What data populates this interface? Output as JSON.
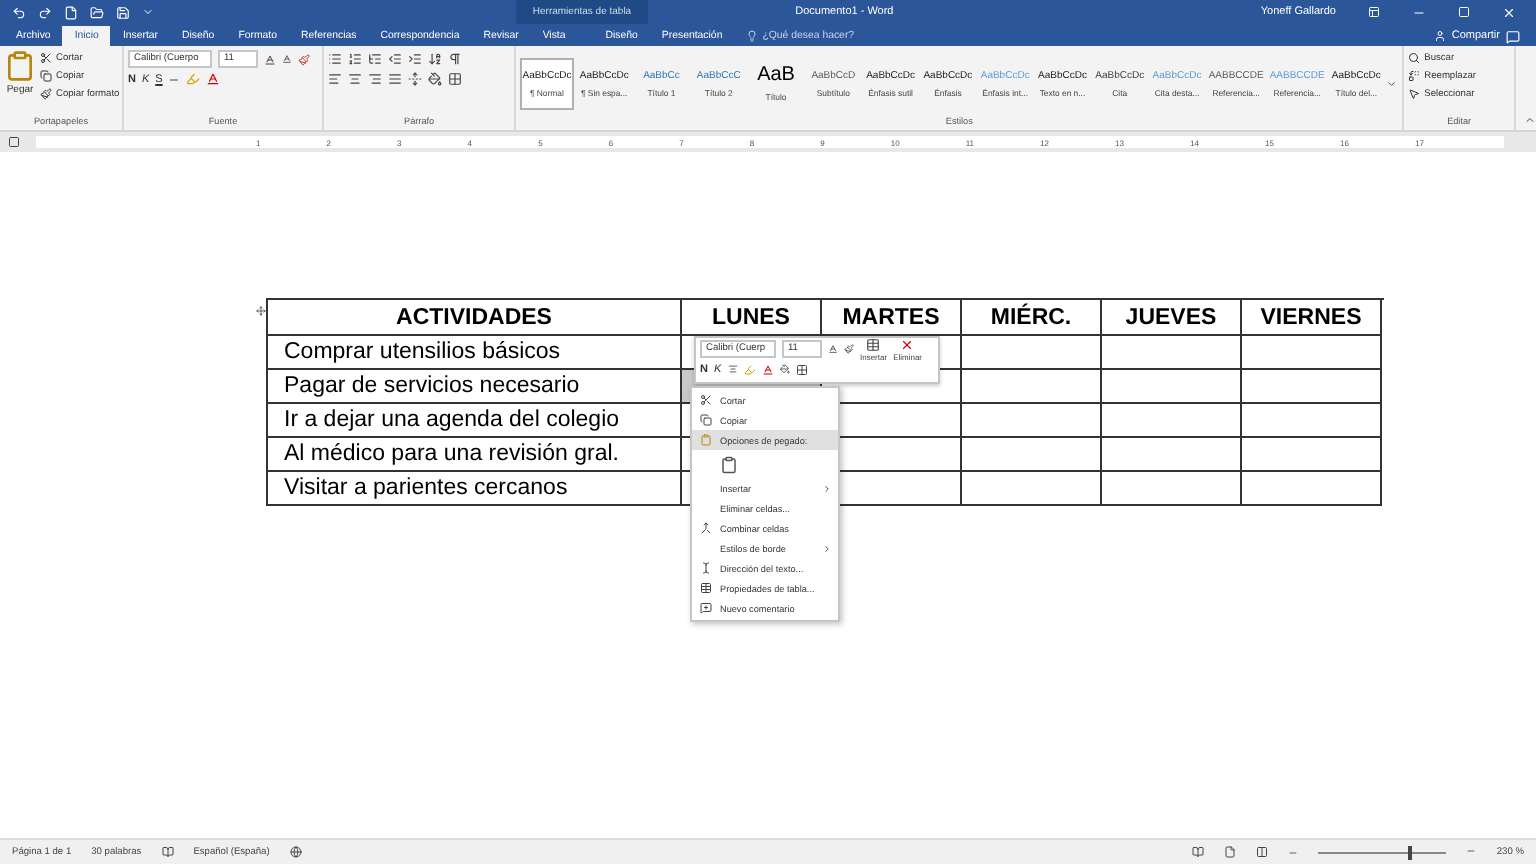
{
  "title_bar": {
    "context_label": "Herramientas de tabla",
    "title": "Documento1 - Word",
    "user": "Yoneff Gallardo"
  },
  "tabs": [
    {
      "label": "Archivo",
      "selected": false,
      "kind": "tab"
    },
    {
      "label": "Inicio",
      "selected": true,
      "kind": "tab"
    },
    {
      "label": "Insertar",
      "selected": false,
      "kind": "tab"
    },
    {
      "label": "Diseño",
      "selected": false,
      "kind": "tab"
    },
    {
      "label": "Formato",
      "selected": false,
      "kind": "tab"
    },
    {
      "label": "Referencias",
      "selected": false,
      "kind": "tab"
    },
    {
      "label": "Correspondencia",
      "selected": false,
      "kind": "tab"
    },
    {
      "label": "Revisar",
      "selected": false,
      "kind": "tab"
    },
    {
      "label": "Vista",
      "selected": false,
      "kind": "tab"
    },
    {
      "label": "Diseño",
      "selected": false,
      "kind": "context"
    },
    {
      "label": "Presentación",
      "selected": false,
      "kind": "context"
    },
    {
      "label": "¿Qué desea hacer?",
      "selected": false,
      "kind": "search"
    }
  ],
  "share": "Compartir",
  "clipboard": {
    "paste": "Pegar",
    "items": [
      "Cortar",
      "Copiar",
      "Copiar formato"
    ],
    "label": "Portapapeles"
  },
  "font": {
    "name": "Calibri (Cuerpo",
    "size": "11",
    "format_buttons": [
      "N",
      "K",
      "S"
    ],
    "label": "Fuente"
  },
  "paragraph": {
    "label": "Párrafo"
  },
  "styles": {
    "label": "Estilos",
    "items": [
      {
        "preview": "AaBbCcDc",
        "name": "¶ Normal",
        "selected": true
      },
      {
        "preview": "AaBbCcDc",
        "name": "¶ Sin espa...",
        "selected": false
      },
      {
        "preview": "AaBbCc",
        "name": "Título 1",
        "selected": false,
        "color": "#2e74b5"
      },
      {
        "preview": "AaBbCcC",
        "name": "Título 2",
        "selected": false,
        "color": "#2e74b5"
      },
      {
        "preview": "AaB",
        "name": "Título",
        "selected": false,
        "color": "#000000"
      },
      {
        "preview": "AaBbCcD",
        "name": "Subtítulo",
        "selected": false,
        "color": "#5a5a5a"
      },
      {
        "preview": "AaBbCcDc",
        "name": "Énfasis sutil",
        "selected": false
      },
      {
        "preview": "AaBbCcDc",
        "name": "Énfasis",
        "selected": false
      },
      {
        "preview": "AaBbCcDc",
        "name": "Énfasis int...",
        "selected": false,
        "color": "#5b9bd5"
      },
      {
        "preview": "AaBbCcDc",
        "name": "Texto en n...",
        "selected": false
      },
      {
        "preview": "AaBbCcDc",
        "name": "Cita",
        "selected": false,
        "color": "#404040"
      },
      {
        "preview": "AaBbCcDc",
        "name": "Cita desta...",
        "selected": false,
        "color": "#5b9bd5"
      },
      {
        "preview": "AABBCCDE",
        "name": "Referencia...",
        "selected": false,
        "color": "#5a5a5a"
      },
      {
        "preview": "AABBCCDE",
        "name": "Referencia...",
        "selected": false,
        "color": "#5b9bd5"
      },
      {
        "preview": "AaBbCcDc",
        "name": "Título del...",
        "selected": false
      }
    ]
  },
  "editing": {
    "items": [
      "Buscar",
      "Reemplazar",
      "Seleccionar"
    ],
    "label": "Editar"
  },
  "ruler": {
    "numbers": [
      "1",
      "2",
      "3",
      "4",
      "5",
      "6",
      "7",
      "8",
      "9",
      "10",
      "11",
      "12",
      "13",
      "14",
      "15",
      "16",
      "17"
    ]
  },
  "table": {
    "columns": [
      "ACTIVIDADES",
      "LUNES",
      "MARTES",
      "MIÉRC.",
      "JUEVES",
      "VIERNES"
    ],
    "rows": [
      {
        "activity": "Comprar utensilios básicos",
        "day_cells": [
          {
            "selected": false
          },
          {
            "selected": false
          },
          {
            "selected": false
          },
          {
            "selected": false
          },
          {
            "selected": false
          }
        ]
      },
      {
        "activity": "Pagar de servicios necesario",
        "day_cells": [
          {
            "selected": true
          },
          {
            "selected": false
          },
          {
            "selected": false
          },
          {
            "selected": false
          },
          {
            "selected": false
          }
        ]
      },
      {
        "activity": "Ir a dejar una agenda del colegio",
        "day_cells": [
          {
            "selected": false
          },
          {
            "selected": false
          },
          {
            "selected": false
          },
          {
            "selected": false
          },
          {
            "selected": false
          }
        ]
      },
      {
        "activity": "Al médico para una revisión gral.",
        "day_cells": [
          {
            "selected": false
          },
          {
            "selected": false
          },
          {
            "selected": false
          },
          {
            "selected": false
          },
          {
            "selected": false
          }
        ]
      },
      {
        "activity": "Visitar a parientes cercanos",
        "day_cells": [
          {
            "selected": false
          },
          {
            "selected": false
          },
          {
            "selected": false
          },
          {
            "selected": false
          },
          {
            "selected": false
          }
        ]
      }
    ]
  },
  "mini_toolbar": {
    "font": "Calibri (Cuerp",
    "size": "11",
    "format_buttons": [
      "N",
      "K"
    ],
    "insert": "Insertar",
    "delete": "Eliminar"
  },
  "context_menu": [
    {
      "label": "Cortar",
      "kind": "cut",
      "selected": false
    },
    {
      "label": "Copiar",
      "kind": "copy",
      "selected": false
    },
    {
      "label": "Opciones de pegado:",
      "kind": "paste",
      "selected": true
    },
    {
      "kind": "paste_option",
      "selected": false
    },
    {
      "label": "Insertar",
      "kind": "submenu",
      "selected": false
    },
    {
      "label": "Eliminar celdas...",
      "kind": "plain",
      "selected": false
    },
    {
      "label": "Combinar celdas",
      "kind": "merge",
      "selected": false
    },
    {
      "label": "Estilos de borde",
      "kind": "submenu",
      "selected": false
    },
    {
      "label": "Dirección del texto...",
      "kind": "direction",
      "selected": false
    },
    {
      "label": "Propiedades de tabla...",
      "kind": "properties",
      "selected": false
    },
    {
      "label": "Nuevo comentario",
      "kind": "comment",
      "selected": false
    }
  ],
  "status_bar": {
    "page": "Página 1 de 1",
    "words": "30 palabras",
    "language": "Español (España)",
    "zoom": "230 %",
    "zoom_level": {
      "level": 0.7
    }
  }
}
